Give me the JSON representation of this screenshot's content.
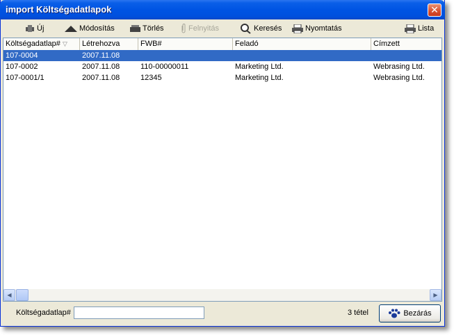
{
  "window": {
    "title": "import Költségadatlapok"
  },
  "toolbar": {
    "new_label": "Új",
    "modify_label": "Módosítás",
    "delete_label": "Törlés",
    "upload_label": "Felnyitás",
    "search_label": "Keresés",
    "print_label": "Nyomtatás",
    "list_label": "Lista"
  },
  "table": {
    "columns": [
      "Költségadatlap#",
      "Létrehozva",
      "FWB#",
      "Feladó",
      "Címzett"
    ],
    "rows": [
      [
        "107-0004",
        "2007.11.08",
        "",
        "",
        ""
      ],
      [
        "107-0002",
        "2007.11.08",
        "110-00000011",
        "Marketing Ltd.",
        "Webrasing Ltd."
      ],
      [
        "107-0001/1",
        "2007.11.08",
        "12345",
        "Marketing Ltd.",
        "Webrasing Ltd."
      ]
    ]
  },
  "footer": {
    "search_label": "Költségadatlap#",
    "search_value": "",
    "count_text": "3 tétel",
    "close_label": "Bezárás"
  },
  "colors": {
    "title_bar": "#0054e3",
    "selection": "#316ac5",
    "window_bg": "#ece9d8"
  }
}
